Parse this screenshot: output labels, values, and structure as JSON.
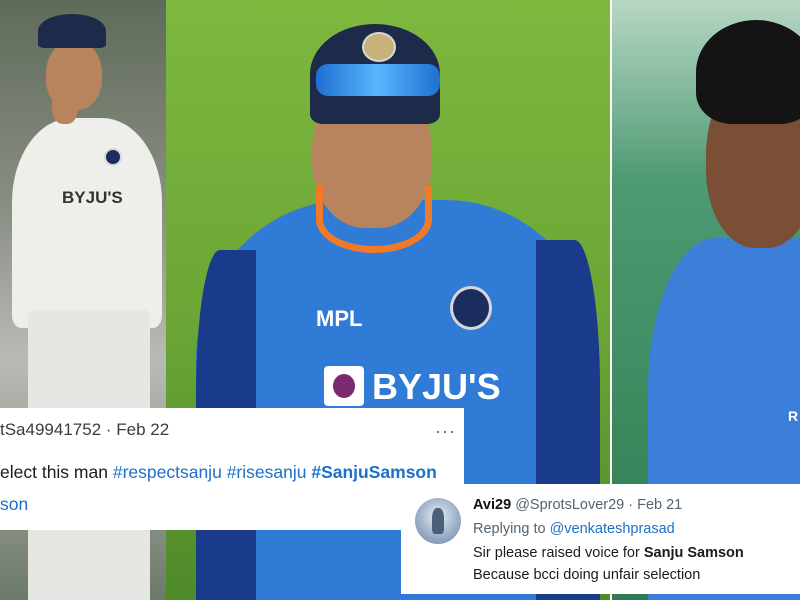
{
  "photos": {
    "left_shirt_text": "BYJU'S",
    "center_sponsor": "MPL",
    "center_shirt_text": "BYJU'S",
    "right_edge_text": "R"
  },
  "tweet_left": {
    "handle_fragment": "tSa49941752",
    "date": "· Feb 22",
    "more": "···",
    "body_start": "elect this man",
    "hashtags": [
      "#respectsanju",
      "#risesanju",
      "#SanjuSamson"
    ],
    "body_end": "son"
  },
  "tweet_right": {
    "name": "Avi29",
    "handle": "@SprotsLover29",
    "date": "· Feb 21",
    "replying_prefix": "Replying to",
    "replying_to": "@venkateshprasad",
    "line1_start": "Sir please raised voice for",
    "line1_bold": "Sanju Samson",
    "line2": "Because bcci doing unfair selection"
  },
  "colors": {
    "link": "#1d70c9",
    "india_blue": "#2f7bd6",
    "collar_orange": "#f07a2a"
  }
}
